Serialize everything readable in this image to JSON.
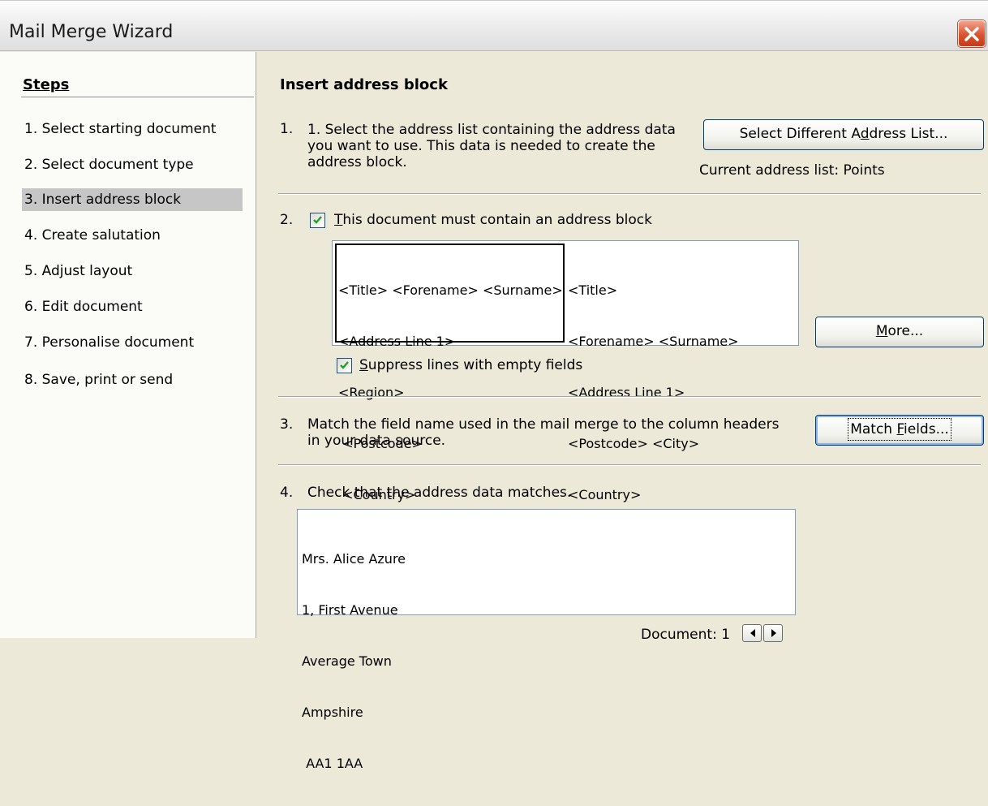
{
  "window": {
    "title": "Mail Merge Wizard"
  },
  "sidebar": {
    "heading": "Steps",
    "steps": [
      {
        "label": "1.  Select starting document",
        "active": false
      },
      {
        "label": "2.  Select document type",
        "active": false
      },
      {
        "label": "3.  Insert address block",
        "active": true
      },
      {
        "label": "4.  Create salutation",
        "active": false
      },
      {
        "label": "5.  Adjust layout",
        "active": false
      },
      {
        "label": "6.  Edit document",
        "active": false
      },
      {
        "label": "7.  Personalise document",
        "active": false
      },
      {
        "label": "8.  Save, print or send",
        "active": false
      }
    ]
  },
  "main": {
    "heading": "Insert address block",
    "section1": {
      "number": "1.",
      "text": "1. Select the address list containing the address data you want to use. This data is needed to create the address block.",
      "button_label": "Select Different Address List...",
      "current_list": "Current address list: Points"
    },
    "section2": {
      "number": "2.",
      "checkbox_label": "This document must contain an address block",
      "checked": true,
      "layout_a": [
        "<Title> <Forename> <Surname>",
        "<Address Line 1>",
        "<Region>",
        " <Postcode>",
        " <Country>"
      ],
      "layout_b": [
        "<Title>",
        "<Forename> <Surname>",
        "<Address Line 1>",
        "<Postcode> <City>",
        "<Country>"
      ],
      "more_button": "More...",
      "suppress_label": "Suppress lines with empty fields",
      "suppress_checked": true
    },
    "section3": {
      "number": "3.",
      "text": "Match the field name used in the mail merge to the column headers in your data source.",
      "button_label": "Match Fields..."
    },
    "section4": {
      "number": "4.",
      "text": "Check that the address data matches.",
      "address_lines": [
        "Mrs. Alice Azure",
        "1, First Avenue",
        "Average Town",
        "Ampshire",
        " AA1 1AA"
      ],
      "document_label": "Document: 1"
    }
  }
}
